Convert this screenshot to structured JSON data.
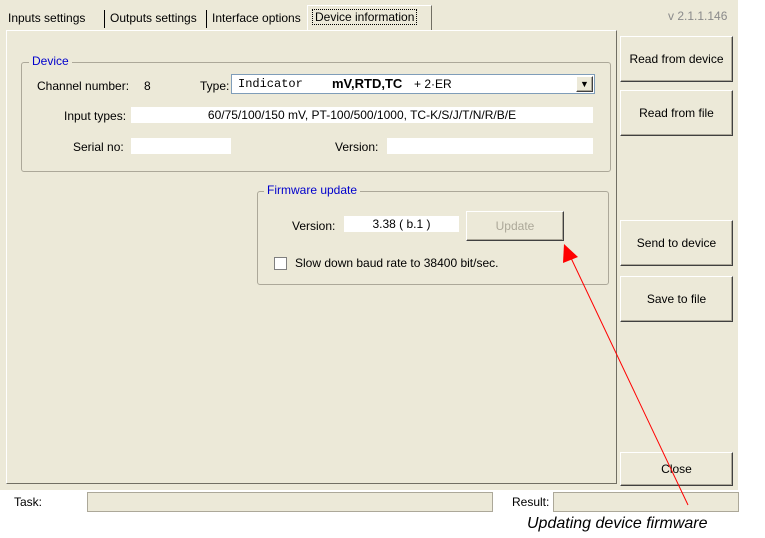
{
  "app": {
    "version": "v 2.1.1.146"
  },
  "tabs": [
    {
      "label": "Inputs settings"
    },
    {
      "label": "Outputs settings"
    },
    {
      "label": "Interface options"
    },
    {
      "label": "Device information"
    }
  ],
  "device": {
    "legend": "Device",
    "channel_label": "Channel number:",
    "channel_value": "8",
    "type_label": "Type:",
    "type_value_name": "Indicator",
    "type_value_bold": "mV,RTD,TC",
    "type_value_extra": "+ 2·ER",
    "input_types_label": "Input types:",
    "input_types_value": "60/75/100/150 mV,  PT-100/500/1000,  TC-K/S/J/T/N/R/B/E",
    "serial_label": "Serial no:",
    "serial_value": "",
    "version_label": "Version:",
    "version_value": ""
  },
  "firmware": {
    "legend": "Firmware update",
    "version_label": "Version:",
    "version_value": "3.38  ( b.1 )",
    "update_button": "Update",
    "slow_checkbox_label": "Slow down baud rate to 38400 bit/sec.",
    "slow_checked": false
  },
  "sidebar": {
    "read_device": "Read from device",
    "read_file": "Read from file",
    "send_device": "Send to device",
    "save_file": "Save to file",
    "close": "Close"
  },
  "status": {
    "task_label": "Task:",
    "task_value": "",
    "result_label": "Result:",
    "result_value": ""
  },
  "annotation": {
    "caption": "Updating device firmware",
    "color": "#ff0000"
  }
}
